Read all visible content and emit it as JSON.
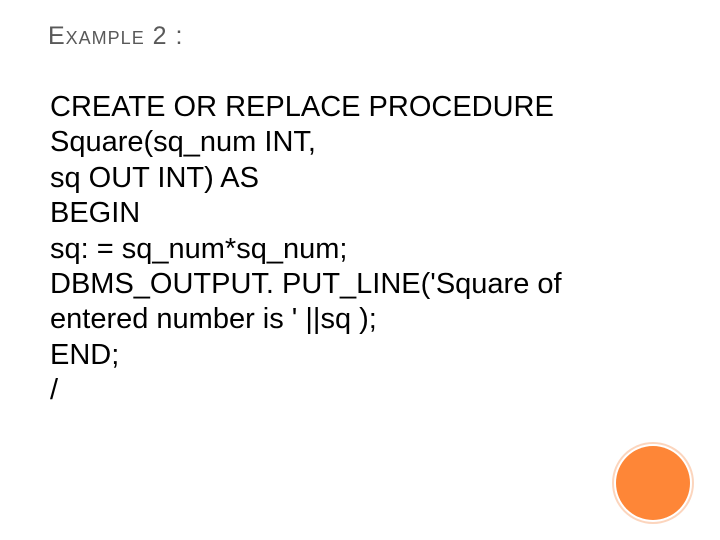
{
  "slide": {
    "title": "Example 2 :",
    "code_lines": [
      "CREATE OR REPLACE PROCEDURE",
      "Square(sq_num INT,",
      "sq OUT INT) AS",
      "BEGIN",
      "sq: = sq_num*sq_num;",
      "DBMS_OUTPUT. PUT_LINE('Square of",
      "entered number is ' ||sq );",
      "END;",
      "/"
    ]
  },
  "accent_color": "#fe8637"
}
